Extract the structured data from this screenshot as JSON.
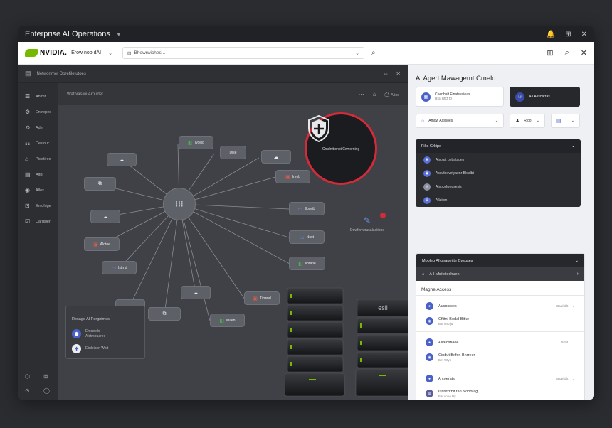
{
  "window": {
    "title": "Enterprise AI Operations",
    "controls": [
      "🔔",
      "⊞",
      "✕"
    ]
  },
  "browser": {
    "brand": "NVIDIA.",
    "context": "Erow nob dAI",
    "url": "Bhowrwiches...",
    "right_controls": [
      "⊞",
      "🔍",
      "✕"
    ]
  },
  "workspace": {
    "title": "Networimer Dorefiletutoes",
    "controls": [
      "⇔",
      "✕"
    ]
  },
  "sidebar": {
    "items": [
      {
        "icon": "☰",
        "label": "Ahlmr"
      },
      {
        "icon": "⚙",
        "label": "Entrepes"
      },
      {
        "icon": "⟲",
        "label": "Adel"
      },
      {
        "icon": "☷",
        "label": "Deslour"
      },
      {
        "icon": "⌂",
        "label": "Pieqtiree"
      },
      {
        "icon": "▤",
        "label": "Aitol"
      },
      {
        "icon": "◉",
        "label": "Alles"
      },
      {
        "icon": "⊡",
        "label": "Entohige"
      },
      {
        "icon": "☑",
        "label": "Cargsier"
      }
    ],
    "bottom": [
      "⬡",
      "⊠",
      "⊙",
      "◯"
    ]
  },
  "canvas_header": {
    "title": "Wathiasiwi Aroudet",
    "menu": "⋯",
    "home": "⌂",
    "action_label": "Alios"
  },
  "graph": {
    "hub_icon": "⁝⁝⁝",
    "nodes": [
      {
        "label": "Ivoeib",
        "icon": "◧",
        "color": "#4caf50"
      },
      {
        "label": "Dise",
        "icon": "",
        "color": ""
      },
      {
        "label": "",
        "icon": "☁",
        "color": "#ffffff"
      },
      {
        "label": "",
        "icon": "☁",
        "color": "#ffffff"
      },
      {
        "label": "Inrob",
        "icon": "▣",
        "color": "#e05a4a"
      },
      {
        "label": "",
        "icon": "⧉",
        "color": "#ffffff"
      },
      {
        "label": "Ilosetb",
        "icon": "▭",
        "color": "#6a8fe0"
      },
      {
        "label": "",
        "icon": "☁",
        "color": "#ffffff"
      },
      {
        "label": "Noxt",
        "icon": "▭",
        "color": "#6a8fe0"
      },
      {
        "label": "Alotoe",
        "icon": "▣",
        "color": "#e05a4a"
      },
      {
        "label": "Ilotarie",
        "icon": "◧",
        "color": "#4caf50"
      },
      {
        "label": "Istrnd",
        "icon": "▭",
        "color": "#6a8fe0"
      },
      {
        "label": "",
        "icon": "☁",
        "color": "#ffffff"
      },
      {
        "label": "",
        "icon": "☁",
        "color": "#ffffff"
      },
      {
        "label": "Tiownd",
        "icon": "▣",
        "color": "#e05a4a"
      },
      {
        "label": "",
        "icon": "⧉",
        "color": "#ffffff"
      },
      {
        "label": "Maeh",
        "icon": "◧",
        "color": "#4caf50"
      }
    ]
  },
  "security": {
    "label": "Crndnittonst Cwnorning",
    "ring_color": "#d32b3a"
  },
  "deploy": {
    "label": "Dowfer wrusalaatione",
    "icon": "✎"
  },
  "legend": {
    "title": "Resage Al Porgnimes",
    "items": [
      {
        "icon": "⬢",
        "line1": "Entobetb",
        "line2": "Alctroouaree"
      },
      {
        "icon": "✚",
        "line1": "Ebdeicon Wbit",
        "line2": ""
      }
    ]
  },
  "server_label": "esil",
  "panel": {
    "title": "Al Agert Mawagemt Cmelo",
    "card1": {
      "line1": "Cuonbalt Finatsexieas",
      "line2": "Bsa nrct tb"
    },
    "card2": {
      "label": "A-I Asscarras"
    },
    "row2": [
      {
        "label": "Amow Asssoes",
        "chev": "⌄"
      },
      {
        "label": "Rioo",
        "chev": "⌄"
      },
      {
        "label": "",
        "chev": "⌄"
      }
    ],
    "dropdown": {
      "title": "Fiko Grkipe",
      "items": [
        {
          "label": "Aisoart bebatages",
          "color": "#5a6fd6"
        },
        {
          "label": "Ascuthevetyaonr Blealbt",
          "color": "#5a6fd6"
        },
        {
          "label": "Aisocolwepsesis",
          "color": "#8c90a0"
        },
        {
          "label": "Allation",
          "color": "#5a6fd6"
        }
      ]
    },
    "access": {
      "header": "Moolep Afronageitte Cvsgses",
      "sub": "A-l ivfnitetechuen",
      "title": "Magne Access",
      "groups": [
        {
          "r1": "Aucosrses",
          "r1_right": "Bsa/sblt",
          "r2": "Cflitni Bodal Bitke",
          "r2_sub": "Bat ono ju"
        },
        {
          "r1": "Aiveosfiaee",
          "r1_right": "Bsbit",
          "r2": "Cindut Bxfon Bnrreer",
          "r2_sub": "Eet Wtyp"
        },
        {
          "r1": "A coerats",
          "r1_right": "Bsa/sblt",
          "r2": "Irisivtdrbit tan Nooorag",
          "r2_sub": "Bat vono Dy"
        }
      ]
    }
  }
}
